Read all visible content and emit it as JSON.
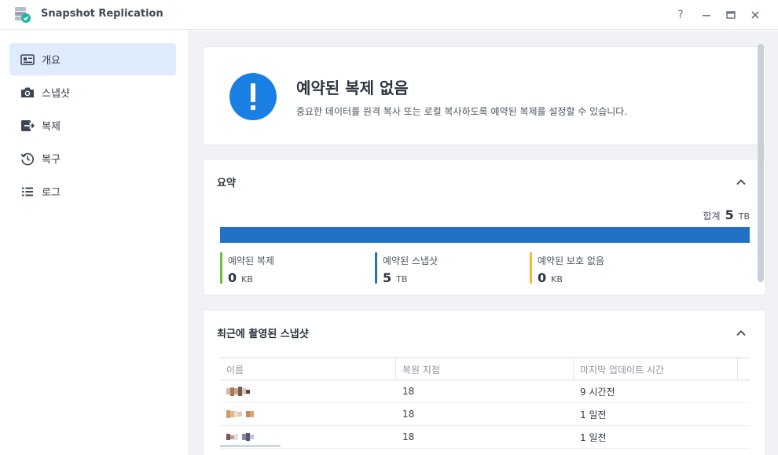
{
  "window": {
    "title": "Snapshot Replication",
    "buttons": {
      "help": "?",
      "minimize": "—",
      "maximize": "▭",
      "close": "✕"
    }
  },
  "sidebar": {
    "items": [
      {
        "label": "개요",
        "icon": "overview-icon",
        "active": true
      },
      {
        "label": "스냅샷",
        "icon": "camera-icon",
        "active": false
      },
      {
        "label": "복제",
        "icon": "replication-icon",
        "active": false
      },
      {
        "label": "복구",
        "icon": "restore-history-icon",
        "active": false
      },
      {
        "label": "로그",
        "icon": "log-list-icon",
        "active": false
      }
    ]
  },
  "hero": {
    "title": "예약된 복제 없음",
    "description": "중요한 데이터를 원격 복사 또는 로컬 복사하도록 예약된 복제를 설정할 수 있습니다."
  },
  "summary": {
    "title": "요약",
    "total_label": "합계",
    "total_value": "5",
    "total_unit": "TB",
    "usage_fraction": 1.0,
    "stats": [
      {
        "label": "예약된 복제",
        "value": "0",
        "unit": "KB",
        "color": "#6cbf3f"
      },
      {
        "label": "예약된 스냅샷",
        "value": "5",
        "unit": "TB",
        "color": "#2172c7"
      },
      {
        "label": "예약된 보호 없음",
        "value": "0",
        "unit": "KB",
        "color": "#f2b630"
      }
    ]
  },
  "recent": {
    "title": "최근에 촬영된 스냅샷",
    "columns": [
      "이름",
      "복원 지점",
      "마지막 업데이트 시간"
    ],
    "rows": [
      {
        "restore_points": "18",
        "updated": "9 시간전"
      },
      {
        "restore_points": "18",
        "updated": "1 일전"
      },
      {
        "restore_points": "18",
        "updated": "1 일전"
      }
    ]
  },
  "colors": {
    "accent": "#1a7fe3",
    "bar": "#2172c7",
    "active_nav": "#dfecfb"
  }
}
